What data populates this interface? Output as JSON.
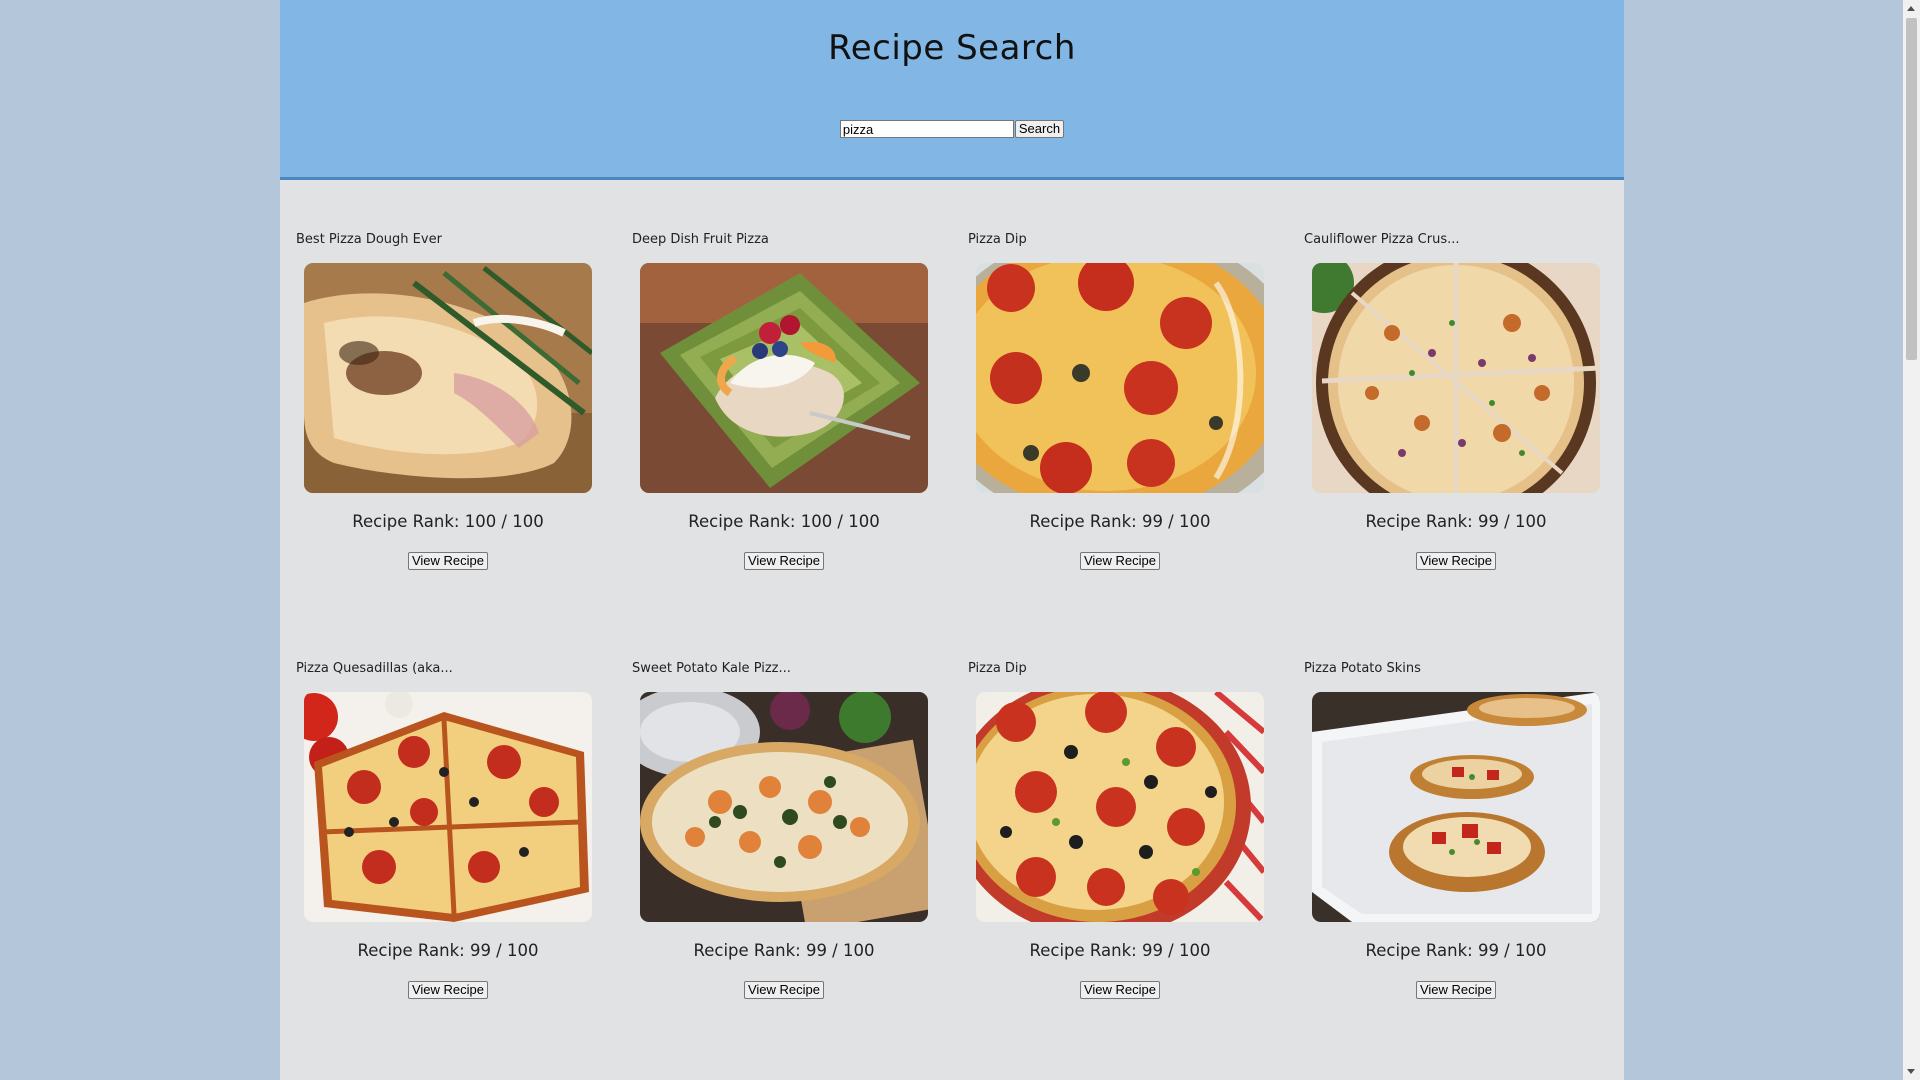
{
  "header": {
    "title": "Recipe Search",
    "search_value": "pizza",
    "search_button": "Search"
  },
  "recipes": [
    {
      "title": "Best Pizza Dough Ever",
      "rank": "Recipe Rank: 100 / 100",
      "button": "View Recipe"
    },
    {
      "title": "Deep Dish Fruit Pizza",
      "rank": "Recipe Rank: 100 / 100",
      "button": "View Recipe"
    },
    {
      "title": "Pizza Dip",
      "rank": "Recipe Rank: 99 / 100",
      "button": "View Recipe"
    },
    {
      "title": "Cauliflower Pizza Crus...",
      "rank": "Recipe Rank: 99 / 100",
      "button": "View Recipe"
    },
    {
      "title": "Pizza Quesadillas (aka...",
      "rank": "Recipe Rank: 99 / 100",
      "button": "View Recipe"
    },
    {
      "title": "Sweet Potato Kale Pizz...",
      "rank": "Recipe Rank: 99 / 100",
      "button": "View Recipe"
    },
    {
      "title": "Pizza Dip",
      "rank": "Recipe Rank: 99 / 100",
      "button": "View Recipe"
    },
    {
      "title": "Pizza Potato Skins",
      "rank": "Recipe Rank: 99 / 100",
      "button": "View Recipe"
    }
  ],
  "colors": {
    "page_background": "#b4c7da",
    "header_background": "#82b6e5",
    "content_background": "#e1e2e4"
  }
}
